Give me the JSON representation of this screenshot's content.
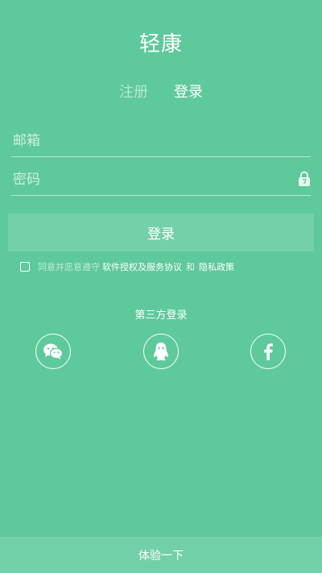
{
  "app": {
    "title": "轻康"
  },
  "tabs": [
    {
      "label": "注册",
      "active": false
    },
    {
      "label": "登录",
      "active": true
    }
  ],
  "form": {
    "email_placeholder": "邮箱",
    "email_value": "",
    "password_placeholder": "密码",
    "password_value": "",
    "lock_icon": "lock-icon",
    "submit_label": "登录"
  },
  "agreement": {
    "checked": false,
    "prefix": "同意并愿意遵守",
    "terms_link": "软件授权及服务协议",
    "and": "和",
    "privacy_link": "隐私政策"
  },
  "third_party": {
    "title": "第三方登录",
    "providers": [
      "wechat-icon",
      "qq-icon",
      "facebook-icon"
    ]
  },
  "footer": {
    "try_label": "体验一下"
  },
  "colors": {
    "background": "#5ec99b",
    "text": "#ffffff"
  }
}
